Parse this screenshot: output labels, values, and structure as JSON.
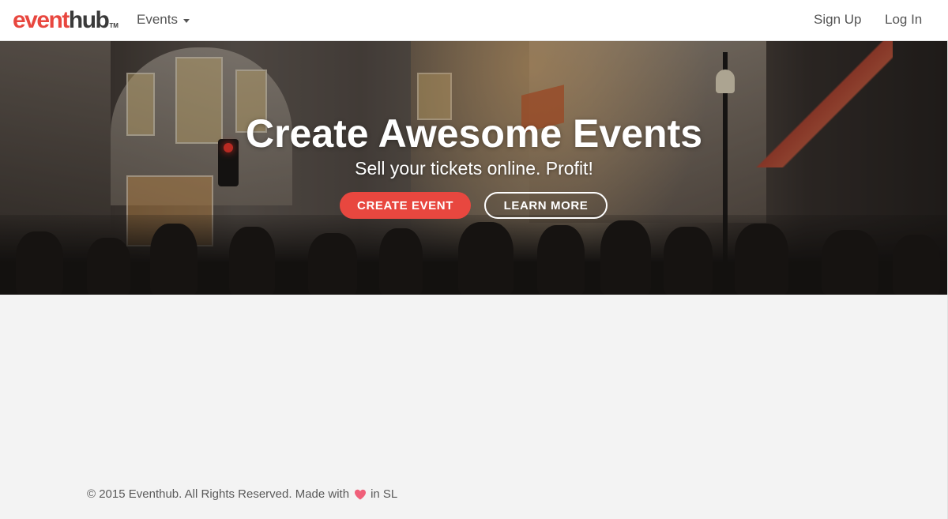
{
  "navbar": {
    "logo": {
      "part1": "event",
      "part2": "hub",
      "tm": "TM"
    },
    "events_menu": "Events",
    "sign_up": "Sign Up",
    "log_in": "Log In"
  },
  "hero": {
    "title": "Create Awesome Events",
    "subtitle": "Sell your tickets online. Profit!",
    "create_button": "CREATE EVENT",
    "learn_button": "LEARN MORE"
  },
  "footer": {
    "text_before": "© 2015 Eventhub. All Rights Reserved. Made with",
    "text_after": "in SL",
    "heart_icon": "heart-icon"
  },
  "colors": {
    "brand_red": "#e8473f",
    "heart": "#f0607a"
  }
}
